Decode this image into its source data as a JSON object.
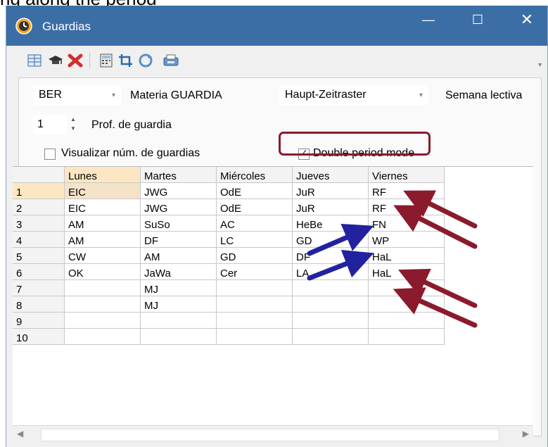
{
  "caption": "ng along the period",
  "window": {
    "title": "Guardias",
    "minimize": "—",
    "maximize": "☐",
    "close": "✕"
  },
  "toolbar": {
    "icons": [
      "table-icon",
      "graduation-cap-icon",
      "delete-icon",
      "calculator-icon",
      "crop-icon",
      "refresh-icon",
      "print-icon"
    ]
  },
  "filters": {
    "teacher_select": "BER",
    "materia_label": "Materia GUARDIA",
    "timegrid_select": "Haupt-Zeitraster",
    "semana_label": "Semana lectiva",
    "prof_value": "1",
    "prof_label": "Prof. de guardia",
    "visualizar_label": "Visualizar núm. de guardias",
    "visualizar_checked": false,
    "double_label": "Double period mode",
    "double_checked": true
  },
  "table": {
    "headers": [
      "",
      "Lunes",
      "Martes",
      "Miércoles",
      "Jueves",
      "Viernes"
    ],
    "rows": [
      [
        "1",
        "EIC",
        "JWG",
        "OdE",
        "JuR",
        "RF"
      ],
      [
        "2",
        "EIC",
        "JWG",
        "OdE",
        "JuR",
        "RF"
      ],
      [
        "3",
        "AM",
        "SuSo",
        "AC",
        "HeBe",
        "FN"
      ],
      [
        "4",
        "AM",
        "DF",
        "LC",
        "GD",
        "WP"
      ],
      [
        "5",
        "CW",
        "AM",
        "GD",
        "DF",
        "HaL"
      ],
      [
        "6",
        "OK",
        "JaWa",
        "Cer",
        "LA",
        "HaL"
      ],
      [
        "7",
        "",
        "MJ",
        "",
        "",
        ""
      ],
      [
        "8",
        "",
        "MJ",
        "",
        "",
        ""
      ],
      [
        "9",
        "",
        "",
        "",
        "",
        ""
      ],
      [
        "10",
        "",
        "",
        "",
        "",
        ""
      ]
    ]
  },
  "colors": {
    "titlebar": "#3c6ea6",
    "red_arrow": "#8b1a2c",
    "blue_arrow": "#2222a0",
    "selected": "#fde7c3"
  }
}
